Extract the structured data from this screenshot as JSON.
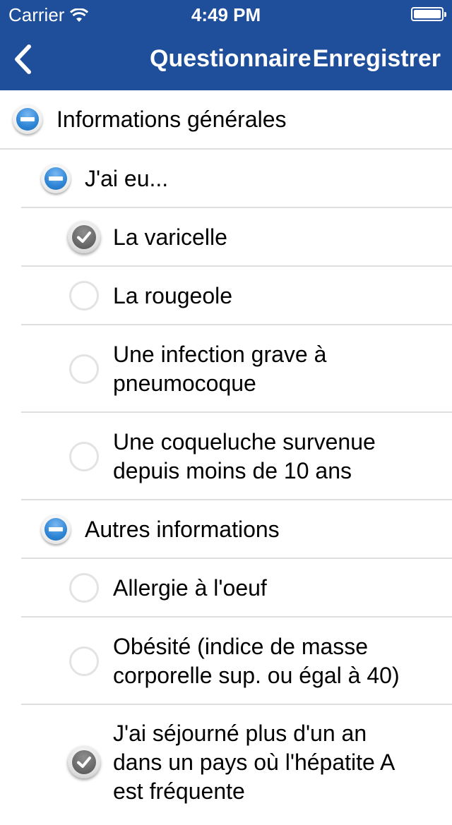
{
  "status_bar": {
    "carrier": "Carrier",
    "time": "4:49 PM"
  },
  "nav": {
    "title": "Questionnaire",
    "save_label": "Enregistrer"
  },
  "sections": {
    "general": {
      "label": "Informations générales"
    },
    "had": {
      "label": "J'ai eu...",
      "items": [
        {
          "line1": "La varicelle",
          "line2": "",
          "checked": true
        },
        {
          "line1": "La rougeole",
          "line2": "",
          "checked": false
        },
        {
          "line1": "Une infection grave à",
          "line2": "pneumocoque",
          "checked": false
        },
        {
          "line1": "Une coqueluche survenue",
          "line2": "depuis moins de 10 ans",
          "checked": false
        }
      ]
    },
    "other": {
      "label": "Autres informations",
      "items": [
        {
          "line1": "Allergie à l'oeuf",
          "line2": "",
          "checked": false
        },
        {
          "line1": "Obésité (indice de masse",
          "line2": "corporelle sup. ou égal à 40)",
          "checked": false
        },
        {
          "line1": "J'ai séjourné plus d'un an",
          "line2": "dans un pays où l'hépatite A",
          "line3": "est fréquente",
          "checked": true
        }
      ]
    }
  },
  "colors": {
    "nav_background": "#1f4f9a",
    "accent_blue": "#2f86d6",
    "separator": "#dedede"
  }
}
